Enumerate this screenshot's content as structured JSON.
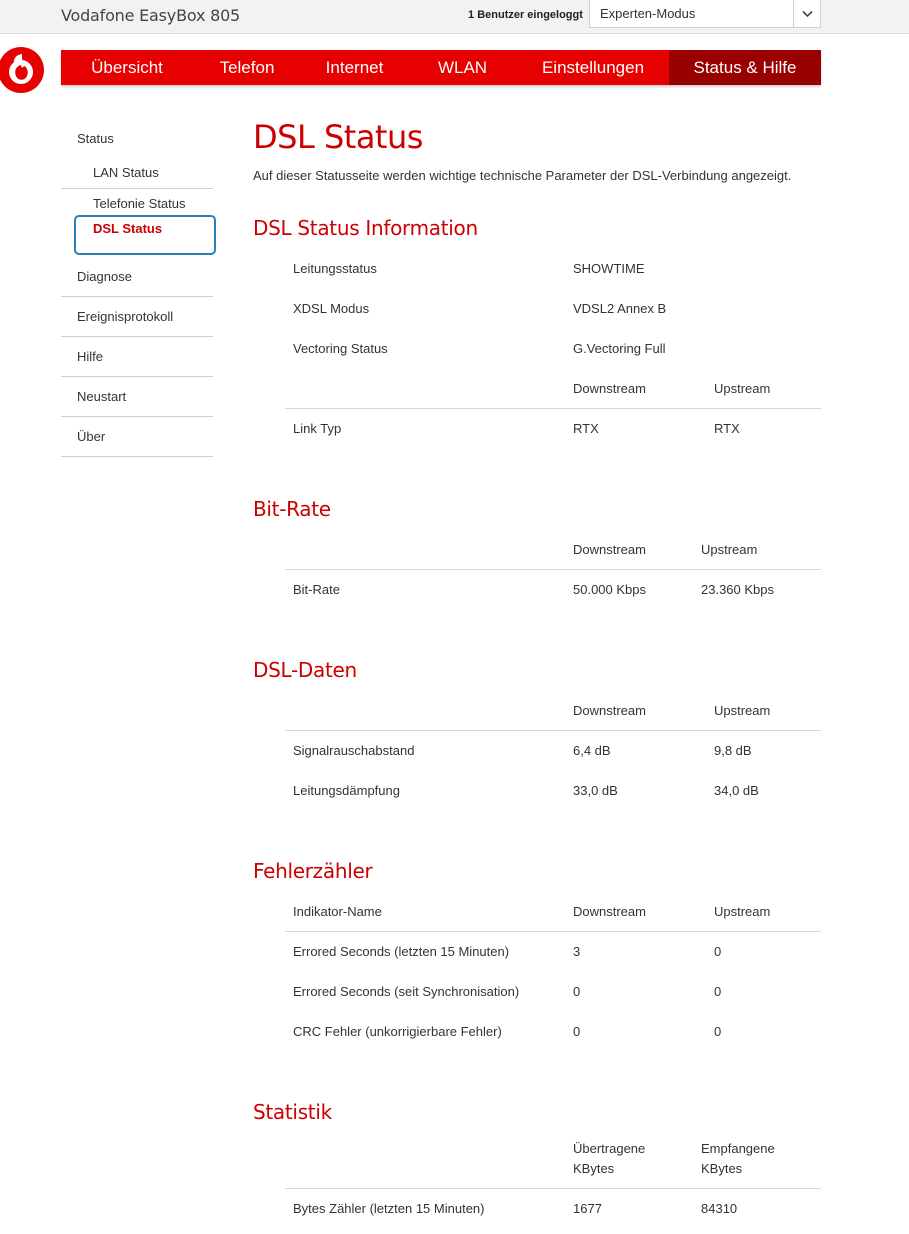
{
  "header": {
    "device_title": "Vodafone EasyBox 805",
    "users_count": "1",
    "users_text": "Benutzer eingeloggt",
    "mode_value": "Experten-Modus"
  },
  "nav": {
    "tabs": [
      "Übersicht",
      "Telefon",
      "Internet",
      "WLAN",
      "Einstellungen",
      "Status & Hilfe"
    ],
    "active_tab": "Status & Hilfe"
  },
  "sidebar": {
    "status": "Status",
    "sub_items": [
      "LAN Status",
      "Telefonie Status",
      "DSL Status"
    ],
    "active_item": "DSL Status",
    "items": [
      "Diagnose",
      "Ereignisprotokoll",
      "Hilfe",
      "Neustart",
      "Über"
    ]
  },
  "page": {
    "title": "DSL Status",
    "intro": "Auf dieser Statusseite werden wichtige technische Parameter der DSL-Verbindung angezeigt."
  },
  "sections": {
    "info": {
      "title": "DSL Status Information",
      "rows": [
        {
          "label": "Leitungsstatus",
          "value": "SHOWTIME"
        },
        {
          "label": "XDSL Modus",
          "value": "VDSL2 Annex B"
        },
        {
          "label": "Vectoring Status",
          "value": "G.Vectoring Full"
        }
      ],
      "col_down": "Downstream",
      "col_up": "Upstream",
      "link": {
        "label": "Link Typ",
        "down": "RTX",
        "up": "RTX"
      }
    },
    "bitrate": {
      "title": "Bit-Rate",
      "col_down": "Downstream",
      "col_up": "Upstream",
      "row": {
        "label": "Bit-Rate",
        "down": "50.000 Kbps",
        "up": "23.360 Kbps"
      }
    },
    "dsldata": {
      "title": "DSL-Daten",
      "col_down": "Downstream",
      "col_up": "Upstream",
      "rows": [
        {
          "label": "Signalrauschabstand",
          "down": "6,4 dB",
          "up": "9,8 dB"
        },
        {
          "label": "Leitungsdämpfung",
          "down": "33,0 dB",
          "up": "34,0 dB"
        }
      ]
    },
    "errors": {
      "title": "Fehlerzähler",
      "col_name": "Indikator-Name",
      "col_down": "Downstream",
      "col_up": "Upstream",
      "rows": [
        {
          "label": "Errored Seconds (letzten 15 Minuten)",
          "down": "3",
          "up": "0"
        },
        {
          "label": "Errored Seconds (seit Synchronisation)",
          "down": "0",
          "up": "0"
        },
        {
          "label": "CRC Fehler (unkorrigierbare Fehler)",
          "down": "0",
          "up": "0"
        }
      ]
    },
    "stats": {
      "title": "Statistik",
      "col_sent": "Übertragene KBytes",
      "col_recv": "Empfangene KBytes",
      "row": {
        "label": "Bytes Zähler (letzten 15 Minuten)",
        "sent": "1677",
        "recv": "84310"
      }
    }
  },
  "colors": {
    "brand_red": "#e60000",
    "active_tab": "#990000",
    "heading_red": "#cc0000",
    "focus_ring": "#2a7fb8"
  }
}
